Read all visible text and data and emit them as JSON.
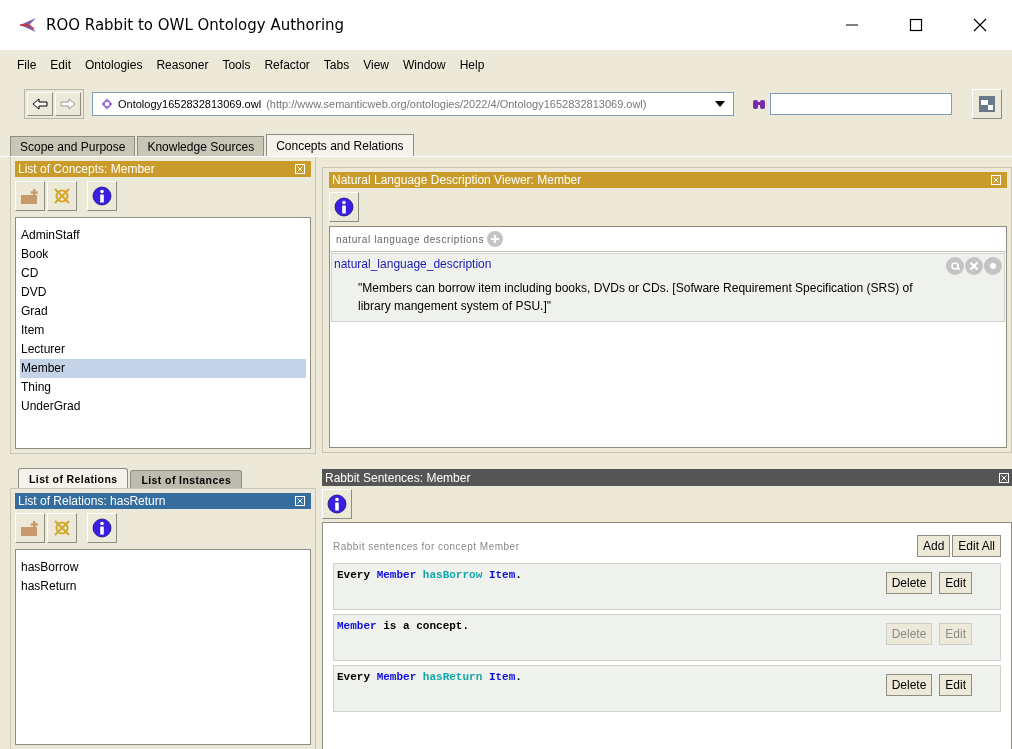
{
  "window": {
    "title": "ROO Rabbit to OWL Ontology Authoring"
  },
  "menu": [
    "File",
    "Edit",
    "Ontologies",
    "Reasoner",
    "Tools",
    "Refactor",
    "Tabs",
    "View",
    "Window",
    "Help"
  ],
  "toolbar": {
    "ontology": "Ontology1652832813069.owl",
    "ontology_uri": "(http://www.semanticweb.org/ontologies/2022/4/Ontology1652832813069.owl)"
  },
  "tabs": [
    {
      "label": "Scope and Purpose",
      "selected": false
    },
    {
      "label": "Knowledge Sources",
      "selected": false
    },
    {
      "label": "Concepts and Relations",
      "selected": true
    }
  ],
  "concepts_panel": {
    "title": "List of Concepts: Member",
    "items": [
      {
        "label": "AdminStaff",
        "selected": false
      },
      {
        "label": "Book",
        "selected": false
      },
      {
        "label": "CD",
        "selected": false
      },
      {
        "label": "DVD",
        "selected": false
      },
      {
        "label": "Grad",
        "selected": false
      },
      {
        "label": "Item",
        "selected": false
      },
      {
        "label": "Lecturer",
        "selected": false
      },
      {
        "label": "Member",
        "selected": true
      },
      {
        "label": "Thing",
        "selected": false
      },
      {
        "label": "UnderGrad",
        "selected": false
      }
    ]
  },
  "description_panel": {
    "title": "Natural Language Description Viewer: Member",
    "section_label": "natural language descriptions",
    "entries": [
      {
        "property": "natural_language_description",
        "value": "\"Members can borrow item including books, DVDs or CDs. [Sofware Requirement Specification (SRS) of library mangement system of PSU.]\""
      }
    ]
  },
  "relations_tabs": [
    {
      "label": "List of Relations",
      "selected": true
    },
    {
      "label": "List of Instances",
      "selected": false
    }
  ],
  "relations_panel": {
    "title": "List of Relations: hasReturn",
    "items": [
      {
        "label": "hasBorrow",
        "selected": false
      },
      {
        "label": "hasReturn",
        "selected": false
      }
    ]
  },
  "sentences_panel": {
    "title": "Rabbit Sentences: Member",
    "caption": "Rabbit sentences for concept Member",
    "buttons": [
      "Add",
      "Edit All"
    ],
    "sentences": [
      {
        "disabled": false,
        "buttons": [
          "Delete",
          "Edit"
        ],
        "tokens": [
          {
            "text": "Every",
            "kind": "keyword"
          },
          {
            "text": "Member",
            "kind": "concept"
          },
          {
            "text": "hasBorrow",
            "kind": "relation"
          },
          {
            "text": "Item",
            "kind": "concept"
          },
          {
            "text": ".",
            "kind": "punct"
          }
        ]
      },
      {
        "disabled": true,
        "buttons": [
          "Delete",
          "Edit"
        ],
        "tokens": [
          {
            "text": "Member",
            "kind": "concept"
          },
          {
            "text": "is a concept",
            "kind": "keyword"
          },
          {
            "text": ".",
            "kind": "punct"
          }
        ]
      },
      {
        "disabled": false,
        "buttons": [
          "Delete",
          "Edit"
        ],
        "tokens": [
          {
            "text": "Every",
            "kind": "keyword"
          },
          {
            "text": "Member",
            "kind": "concept"
          },
          {
            "text": "hasReturn",
            "kind": "relation"
          },
          {
            "text": "Item",
            "kind": "concept"
          },
          {
            "text": ".",
            "kind": "punct"
          }
        ]
      }
    ]
  }
}
